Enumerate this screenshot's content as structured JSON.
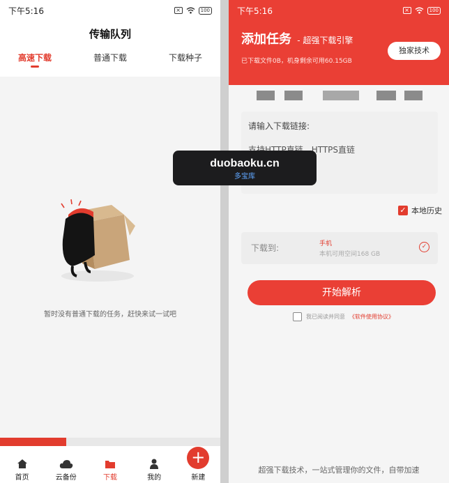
{
  "left": {
    "status_time": "下午5:16",
    "battery": "100",
    "title": "传输队列",
    "tabs": [
      {
        "label": "高速下载",
        "active": true
      },
      {
        "label": "普通下载",
        "active": false
      },
      {
        "label": "下载种子",
        "active": false
      }
    ],
    "empty_text": "暂时没有普通下载的任务，赶快来试一试吧",
    "progress_fraction": 0.3,
    "nav": [
      {
        "label": "首页",
        "icon": "home-icon"
      },
      {
        "label": "云备份",
        "icon": "cloud-icon"
      },
      {
        "label": "下载",
        "icon": "download-icon",
        "active": true
      },
      {
        "label": "我的",
        "icon": "user-icon"
      },
      {
        "label": "新建",
        "icon": "plus-icon"
      }
    ]
  },
  "right": {
    "status_time": "下午5:16",
    "battery": "100",
    "title": "添加任务",
    "subtitle": "- 超强下载引擎",
    "stats": "已下载文件0B，机身剩余可用60.15GB",
    "tech_button": "独家技术",
    "input_label": "请输入下载链接:",
    "input_hint": "支持HTTP直链、HTTPS直链\n        、磁力链Magnet\n        、FTP等",
    "local_history": "本地历史",
    "dest_label": "下载到:",
    "dest_name": "手机",
    "dest_space": "本机可用空间168 GB",
    "parse_button": "开始解析",
    "agree_text": "我已阅读并同意",
    "agree_link": "《软件使用协议》",
    "footer": "超强下载技术，一站式管理你的文件，自带加速"
  },
  "watermark": {
    "domain": "duobaoku.cn",
    "cn": "多宝库"
  },
  "colors": {
    "accent": "#e23c2e",
    "header": "#ea3f35"
  }
}
